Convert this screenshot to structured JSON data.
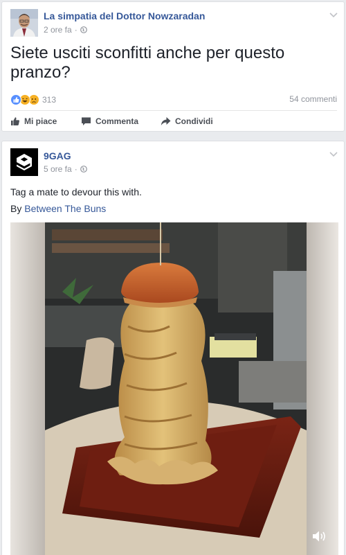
{
  "post1": {
    "page_name": "La simpatia del Dottor Nowzaradan",
    "time": "2 ore fa",
    "separator": "·",
    "text": "Siete usciti sconfitti anche per questo pranzo?",
    "reaction_count": "313",
    "comments": "54 commenti",
    "actions": {
      "like": "Mi piace",
      "comment": "Commenta",
      "share": "Condividi"
    }
  },
  "post2": {
    "page_name": "9GAG",
    "time": "5 ore fa",
    "separator": "·",
    "text": "Tag a mate to devour this with.",
    "by_prefix": "By",
    "by_link": "Between The Buns"
  },
  "colors": {
    "link": "#365899",
    "muted": "#90949c",
    "like_blue": "#5890ff",
    "haha_yellow": "#f7b125"
  }
}
